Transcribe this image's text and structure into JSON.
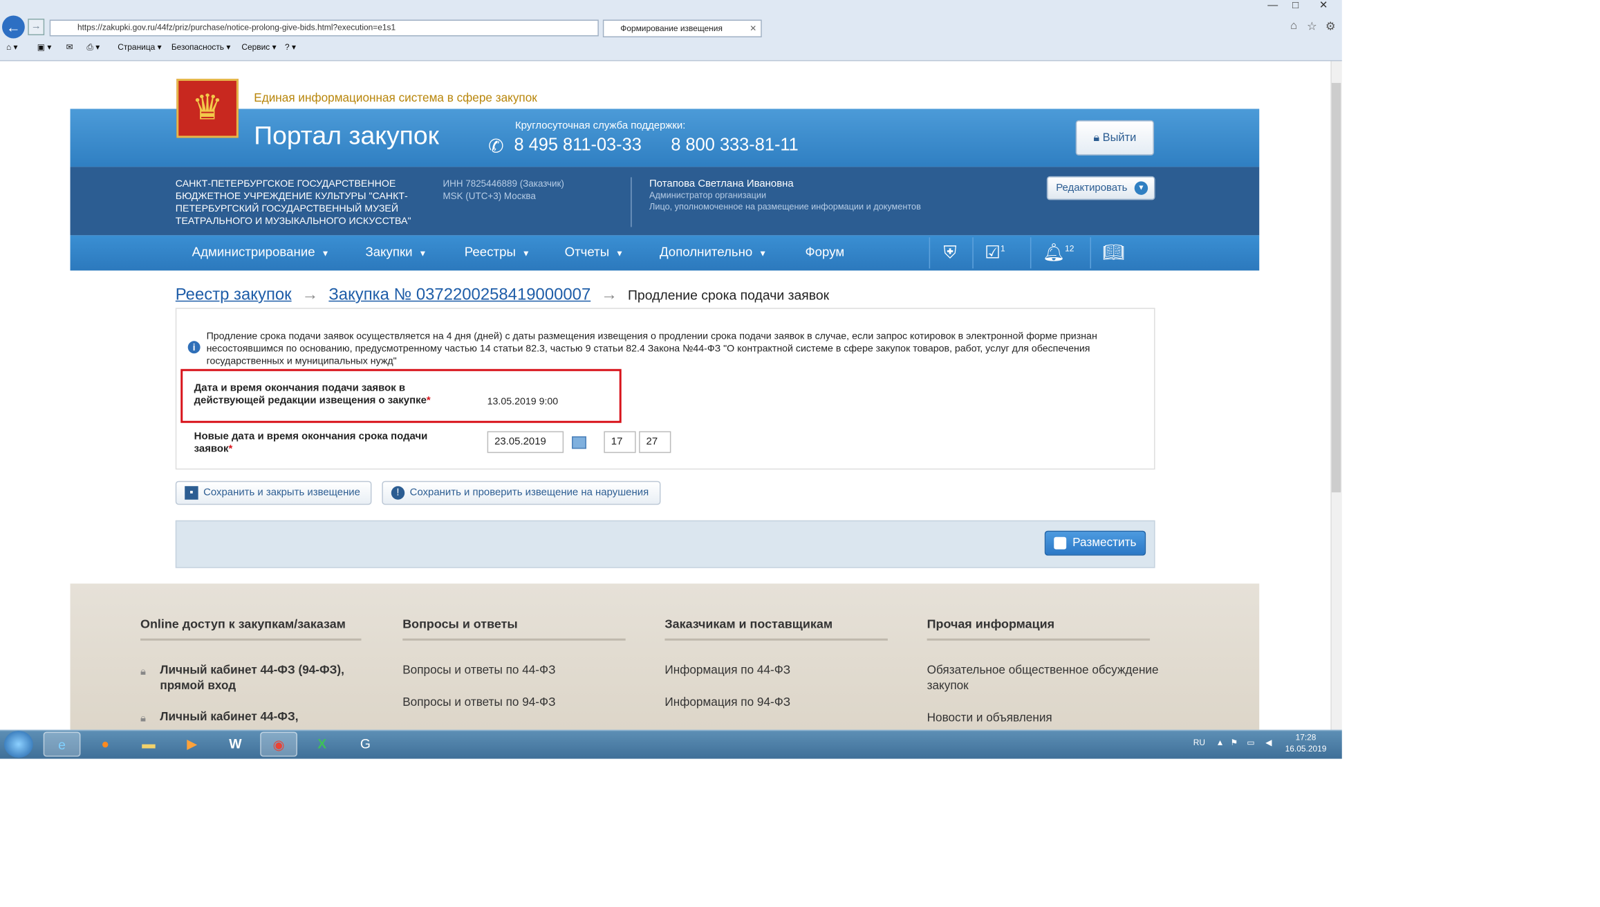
{
  "browser": {
    "url": "https://zakupki.gov.ru/44fz/priz/purchase/notice-prolong-give-bids.html?execution=e1s1",
    "tab_title": "Формирование извещения",
    "toolbar": {
      "page": "Страница",
      "security": "Безопасность",
      "service": "Сервис"
    }
  },
  "header": {
    "site_name": "Единая информационная система в сфере закупок",
    "portal_title": "Портал закупок",
    "support_label": "Круглосуточная служба поддержки:",
    "phone1": "8 495 811-03-33",
    "phone2": "8 800 333-81-11",
    "logout": "Выйти"
  },
  "org_bar": {
    "org_name": "САНКТ-ПЕТЕРБУРГСКОЕ ГОСУДАРСТВЕННОЕ БЮДЖЕТНОЕ УЧРЕЖДЕНИЕ КУЛЬТУРЫ \"САНКТ-ПЕТЕРБУРГСКИЙ ГОСУДАРСТВЕННЫЙ МУЗЕЙ ТЕАТРАЛЬНОГО И МУЗЫКАЛЬНОГО ИСКУССТВА\"",
    "inn": "ИНН 7825446889 (Заказчик)",
    "timezone": "MSK (UTC+3) Москва",
    "user_name": "Потапова Светлана Ивановна",
    "user_role1": "Администратор организации",
    "user_role2": "Лицо, уполномоченное на размещение информации и документов",
    "edit_button": "Редактировать"
  },
  "menu": {
    "items": [
      "Администрирование",
      "Закупки",
      "Реестры",
      "Отчеты",
      "Дополнительно",
      "Форум"
    ],
    "calendar_badge": "1",
    "notifications_badge": "12"
  },
  "breadcrumb": {
    "level1": "Реестр закупок",
    "level2": "Закупка № 0372200258419000007",
    "current": "Продление срока подачи заявок"
  },
  "form": {
    "info_text": "Продление срока подачи заявок осуществляется на 4 дня (дней) с даты размещения извещения о продлении срока подачи заявок в случае, если запрос котировок в электронной форме признан несостоявшимся по основанию, предусмотренному частью 14 статьи 82.3, частью 9 статьи 82.4 Закона №44-ФЗ \"О контрактной системе в сфере закупок товаров, работ, услуг для обеспечения государственных и муниципальных нужд\"",
    "current_deadline_label": "Дата и время окончания подачи заявок в действующей редакции извещения о закупке",
    "current_deadline_value": "13.05.2019 9:00",
    "new_deadline_label": "Новые дата и время окончания срока подачи заявок",
    "new_date": "23.05.2019",
    "new_hour": "17",
    "new_minute": "27",
    "required_mark": "*"
  },
  "actions": {
    "save_close": "Сохранить и закрыть извещение",
    "save_check": "Сохранить и проверить извещение на нарушения",
    "publish": "Разместить"
  },
  "footer": {
    "col1_title": "Online доступ к закупкам/заказам",
    "col1_items": [
      "Личный кабинет 44-ФЗ (94-ФЗ), прямой вход",
      "Личный кабинет 44-ФЗ,"
    ],
    "col2_title": "Вопросы и ответы",
    "col2_items": [
      "Вопросы и ответы по 44-ФЗ",
      "Вопросы и ответы по 94-ФЗ"
    ],
    "col3_title": "Заказчикам и поставщикам",
    "col3_items": [
      "Информация по 44-ФЗ",
      "Информация по 94-ФЗ"
    ],
    "col4_title": "Прочая информация",
    "col4_items": [
      "Обязательное общественное обсуждение закупок",
      "Новости и объявления"
    ]
  },
  "taskbar": {
    "lang": "RU",
    "time": "17:28",
    "date": "16.05.2019"
  },
  "colors": {
    "accent_blue": "#2f7fc2",
    "dark_blue": "#2c5d92",
    "highlight_red": "#d8131b",
    "site_name_gold": "#b8860b"
  }
}
